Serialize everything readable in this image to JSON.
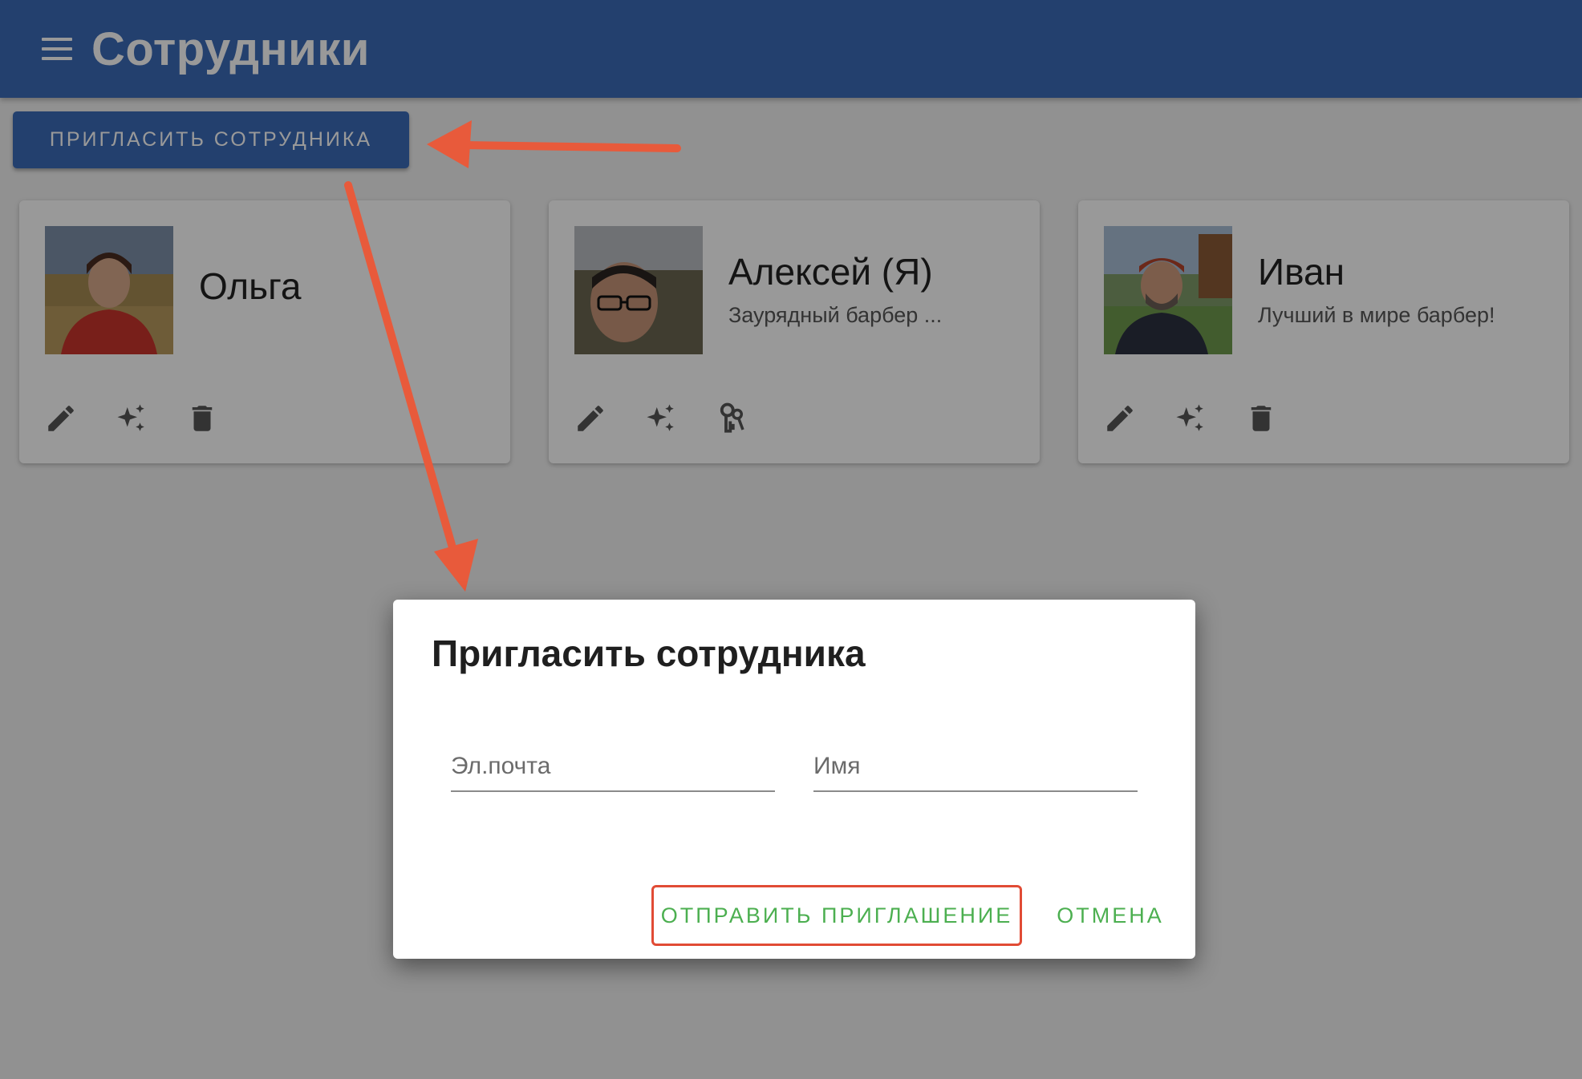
{
  "header": {
    "title": "Сотрудники",
    "menu_icon": "menu-icon"
  },
  "invite_button_label": "ПРИГЛАСИТЬ СОТРУДНИКА",
  "employees": [
    {
      "name": "Ольга",
      "subtitle": "",
      "actions": [
        "pencil-icon",
        "sparkles-icon",
        "trash-icon"
      ]
    },
    {
      "name": "Алексей (Я)",
      "subtitle": "Заурядный барбер ...",
      "actions": [
        "pencil-icon",
        "sparkles-icon",
        "keys-icon"
      ]
    },
    {
      "name": "Иван",
      "subtitle": "Лучший в мире барбер!",
      "actions": [
        "pencil-icon",
        "sparkles-icon",
        "trash-icon"
      ]
    }
  ],
  "dialog": {
    "title": "Пригласить сотрудника",
    "email_placeholder": "Эл.почта",
    "email_value": "",
    "name_placeholder": "Имя",
    "name_value": "",
    "send_label": "ОТПРАВИТЬ ПРИГЛАШЕНИЕ",
    "cancel_label": "ОТМЕНА"
  },
  "colors": {
    "primary": "#3b6bb7",
    "accent_green": "#4caf50",
    "annotation_red": "#e14b35"
  }
}
